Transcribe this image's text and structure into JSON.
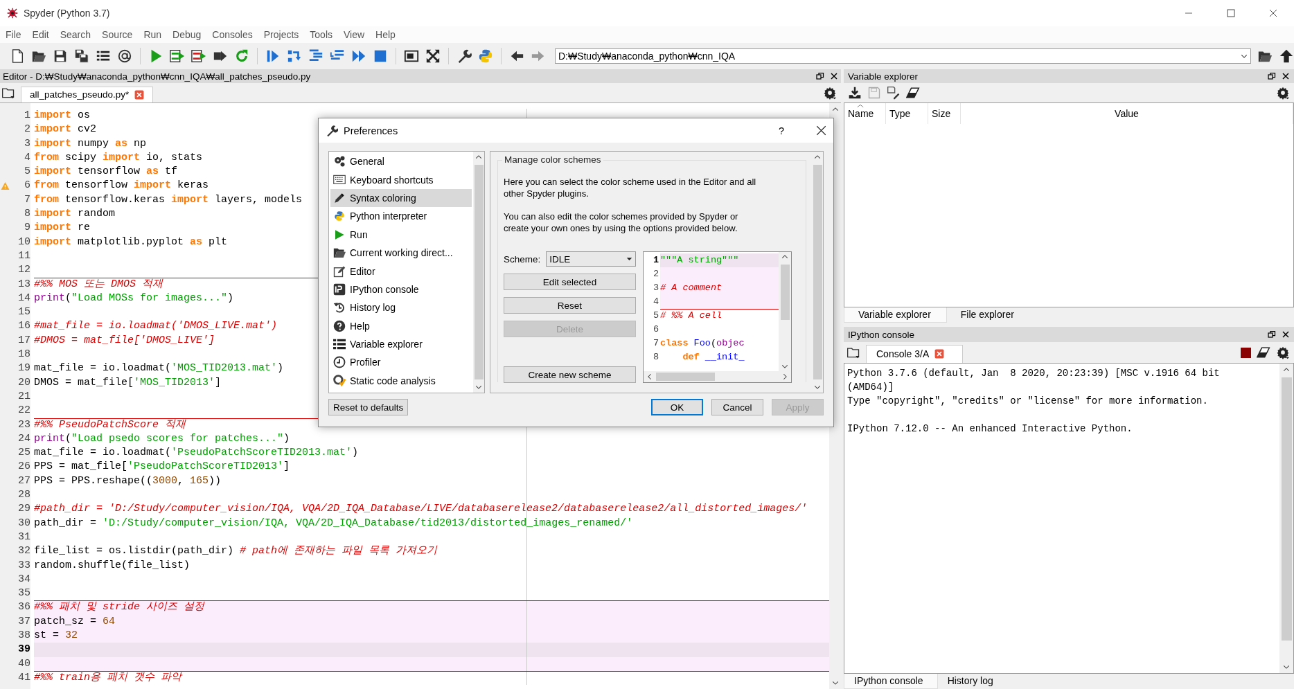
{
  "window": {
    "title": "Spyder (Python 3.7)"
  },
  "menu": [
    "File",
    "Edit",
    "Search",
    "Source",
    "Run",
    "Debug",
    "Consoles",
    "Projects",
    "Tools",
    "View",
    "Help"
  ],
  "toolbar": {
    "working_directory": "D:₩Study₩anaconda_python₩cnn_IQA"
  },
  "editor": {
    "title": "Editor - D:₩Study₩anaconda_python₩cnn_IQA₩all_patches_pseudo.py",
    "tabs": [
      {
        "label": "all_patches_pseudo.py*",
        "selected": true
      }
    ],
    "lines": [
      {
        "number": "1",
        "kind": "code",
        "warning": false,
        "tokens": [
          {
            "kind": "keyword",
            "text": "import"
          },
          {
            "kind": "plain",
            "text": " os"
          }
        ]
      },
      {
        "number": "2",
        "kind": "code",
        "warning": false,
        "tokens": [
          {
            "kind": "keyword",
            "text": "import"
          },
          {
            "kind": "plain",
            "text": " cv2"
          }
        ]
      },
      {
        "number": "3",
        "kind": "code",
        "warning": false,
        "tokens": [
          {
            "kind": "keyword",
            "text": "import"
          },
          {
            "kind": "plain",
            "text": " numpy "
          },
          {
            "kind": "keyword",
            "text": "as"
          },
          {
            "kind": "plain",
            "text": " np"
          }
        ]
      },
      {
        "number": "4",
        "kind": "code",
        "warning": false,
        "tokens": [
          {
            "kind": "keyword",
            "text": "from"
          },
          {
            "kind": "plain",
            "text": " scipy "
          },
          {
            "kind": "keyword",
            "text": "import"
          },
          {
            "kind": "plain",
            "text": " io, stats"
          }
        ]
      },
      {
        "number": "5",
        "kind": "code",
        "warning": false,
        "tokens": [
          {
            "kind": "keyword",
            "text": "import"
          },
          {
            "kind": "plain",
            "text": " tensorflow "
          },
          {
            "kind": "keyword",
            "text": "as"
          },
          {
            "kind": "plain",
            "text": " tf"
          }
        ]
      },
      {
        "number": "6",
        "kind": "code",
        "warning": true,
        "tokens": [
          {
            "kind": "keyword",
            "text": "from"
          },
          {
            "kind": "plain",
            "text": " tensorflow "
          },
          {
            "kind": "keyword",
            "text": "import"
          },
          {
            "kind": "plain",
            "text": " keras"
          }
        ]
      },
      {
        "number": "7",
        "kind": "code",
        "warning": false,
        "tokens": [
          {
            "kind": "keyword",
            "text": "from"
          },
          {
            "kind": "plain",
            "text": " tensorflow.keras "
          },
          {
            "kind": "keyword",
            "text": "import"
          },
          {
            "kind": "plain",
            "text": " layers, models"
          }
        ]
      },
      {
        "number": "8",
        "kind": "code",
        "warning": false,
        "tokens": [
          {
            "kind": "keyword",
            "text": "import"
          },
          {
            "kind": "plain",
            "text": " random"
          }
        ]
      },
      {
        "number": "9",
        "kind": "code",
        "warning": false,
        "tokens": [
          {
            "kind": "keyword",
            "text": "import"
          },
          {
            "kind": "plain",
            "text": " re"
          }
        ]
      },
      {
        "number": "10",
        "kind": "code",
        "warning": false,
        "tokens": [
          {
            "kind": "keyword",
            "text": "import"
          },
          {
            "kind": "plain",
            "text": " matplotlib.pyplot "
          },
          {
            "kind": "keyword",
            "text": "as"
          },
          {
            "kind": "plain",
            "text": " plt"
          }
        ]
      },
      {
        "number": "11",
        "kind": "code",
        "warning": false
      },
      {
        "number": "12",
        "kind": "code",
        "warning": false
      },
      {
        "number": "13",
        "kind": "cell_header",
        "warning": false,
        "tokens": [
          {
            "kind": "comment",
            "text": "#%% MOS 또는 DMOS 적재"
          }
        ]
      },
      {
        "number": "14",
        "kind": "code",
        "warning": false,
        "tokens": [
          {
            "kind": "builtin",
            "text": "print"
          },
          {
            "kind": "plain",
            "text": "("
          },
          {
            "kind": "string",
            "text": "\"Load MOSs for images...\""
          },
          {
            "kind": "plain",
            "text": ")"
          }
        ]
      },
      {
        "number": "15",
        "kind": "code",
        "warning": false
      },
      {
        "number": "16",
        "kind": "code",
        "warning": false,
        "tokens": [
          {
            "kind": "comment",
            "text": "#mat_file = io.loadmat('DMOS_LIVE.mat')"
          }
        ]
      },
      {
        "number": "17",
        "kind": "code",
        "warning": false,
        "tokens": [
          {
            "kind": "comment",
            "text": "#DMOS = mat_file['DMOS_LIVE']"
          }
        ]
      },
      {
        "number": "18",
        "kind": "code",
        "warning": false
      },
      {
        "number": "19",
        "kind": "code",
        "warning": false,
        "tokens": [
          {
            "kind": "plain",
            "text": "mat_file = io.loadmat("
          },
          {
            "kind": "string",
            "text": "'MOS_TID2013.mat'"
          },
          {
            "kind": "plain",
            "text": ")"
          }
        ]
      },
      {
        "number": "20",
        "kind": "code",
        "warning": false,
        "tokens": [
          {
            "kind": "plain",
            "text": "DMOS = mat_file["
          },
          {
            "kind": "string",
            "text": "'MOS_TID2013'"
          },
          {
            "kind": "plain",
            "text": "]"
          }
        ]
      },
      {
        "number": "21",
        "kind": "code",
        "warning": false
      },
      {
        "number": "22",
        "kind": "code",
        "warning": false
      },
      {
        "number": "23",
        "kind": "cell_header",
        "warning": false,
        "tokens": [
          {
            "kind": "comment",
            "text": "#%% PseudoPatchScore 적재"
          }
        ]
      },
      {
        "number": "24",
        "kind": "code",
        "warning": false,
        "tokens": [
          {
            "kind": "builtin",
            "text": "print"
          },
          {
            "kind": "plain",
            "text": "("
          },
          {
            "kind": "string",
            "text": "\"Load psedo scores for patches...\""
          },
          {
            "kind": "plain",
            "text": ")"
          }
        ]
      },
      {
        "number": "25",
        "kind": "code",
        "warning": false,
        "tokens": [
          {
            "kind": "plain",
            "text": "mat_file = io.loadmat("
          },
          {
            "kind": "string",
            "text": "'PseudoPatchScoreTID2013.mat'"
          },
          {
            "kind": "plain",
            "text": ")"
          }
        ]
      },
      {
        "number": "26",
        "kind": "code",
        "warning": false,
        "tokens": [
          {
            "kind": "plain",
            "text": "PPS = mat_file["
          },
          {
            "kind": "string",
            "text": "'PseudoPatchScoreTID2013'"
          },
          {
            "kind": "plain",
            "text": "]"
          }
        ]
      },
      {
        "number": "27",
        "kind": "code",
        "warning": false,
        "tokens": [
          {
            "kind": "plain",
            "text": "PPS = PPS.reshape(("
          },
          {
            "kind": "number",
            "text": "3000"
          },
          {
            "kind": "plain",
            "text": ", "
          },
          {
            "kind": "number",
            "text": "165"
          },
          {
            "kind": "plain",
            "text": "))"
          }
        ]
      },
      {
        "number": "28",
        "kind": "code",
        "warning": false
      },
      {
        "number": "29",
        "kind": "code",
        "warning": false,
        "tokens": [
          {
            "kind": "comment",
            "text": "#path_dir = 'D:/Study/computer_vision/IQA, VQA/2D_IQA_Database/LIVE/databaserelease2/databaserelease2/all_distorted_images/'"
          }
        ]
      },
      {
        "number": "30",
        "kind": "code",
        "warning": false,
        "tokens": [
          {
            "kind": "plain",
            "text": "path_dir = "
          },
          {
            "kind": "string",
            "text": "'D:/Study/computer_vision/IQA, VQA/2D_IQA_Database/tid2013/distorted_images_renamed/'"
          }
        ]
      },
      {
        "number": "31",
        "kind": "code",
        "warning": false
      },
      {
        "number": "32",
        "kind": "code",
        "warning": false,
        "tokens": [
          {
            "kind": "plain",
            "text": "file_list = os.listdir(path_dir) "
          },
          {
            "kind": "comment",
            "text": "# path에 존재하는 파일 목록 가져오기"
          }
        ]
      },
      {
        "number": "33",
        "kind": "code",
        "warning": false,
        "tokens": [
          {
            "kind": "plain",
            "text": "random.shuffle(file_list)"
          }
        ]
      },
      {
        "number": "34",
        "kind": "code",
        "warning": false
      },
      {
        "number": "35",
        "kind": "code",
        "warning": false
      },
      {
        "number": "36",
        "kind": "current_cell_header",
        "warning": false,
        "tokens": [
          {
            "kind": "comment",
            "text": "#%% 패치 및 stride 사이즈 설정"
          }
        ]
      },
      {
        "number": "37",
        "kind": "current_cell",
        "warning": false,
        "tokens": [
          {
            "kind": "plain",
            "text": "patch_sz = "
          },
          {
            "kind": "number",
            "text": "64"
          }
        ]
      },
      {
        "number": "38",
        "kind": "current_cell",
        "warning": false,
        "tokens": [
          {
            "kind": "plain",
            "text": "st = "
          },
          {
            "kind": "number",
            "text": "32"
          }
        ]
      },
      {
        "number": "39",
        "kind": "current_line",
        "warning": false
      },
      {
        "number": "40",
        "kind": "current_cell",
        "warning": false
      },
      {
        "number": "41",
        "kind": "cell_header",
        "warning": false,
        "tokens": [
          {
            "kind": "comment",
            "text": "#%% train용 패치 갯수 파악"
          }
        ]
      }
    ]
  },
  "variable_explorer": {
    "title": "Variable explorer",
    "columns": [
      "Name",
      "Type",
      "Size",
      "Value"
    ],
    "tabs": [
      {
        "label": "Variable explorer",
        "selected": true
      },
      {
        "label": "File explorer",
        "selected": false
      }
    ]
  },
  "ipython_console": {
    "title": "IPython console",
    "tabs": [
      {
        "label": "Console 3/A",
        "selected": true
      }
    ],
    "output": "Python 3.7.6 (default, Jan  8 2020, 20:23:39) [MSC v.1916 64 bit (AMD64)]\nType \"copyright\", \"credits\" or \"license\" for more information.\n\nIPython 7.12.0 -- An enhanced Interactive Python.",
    "bottom_tabs": [
      {
        "label": "IPython console",
        "selected": true
      },
      {
        "label": "History log",
        "selected": false
      }
    ]
  },
  "preferences": {
    "title": "Preferences",
    "help": "?",
    "sections": [
      {
        "label": "General",
        "selected": false
      },
      {
        "label": "Keyboard shortcuts",
        "selected": false
      },
      {
        "label": "Syntax coloring",
        "selected": true
      },
      {
        "label": "Python interpreter",
        "selected": false
      },
      {
        "label": "Run",
        "selected": false
      },
      {
        "label": "Current working direct...",
        "selected": false
      },
      {
        "label": "Editor",
        "selected": false
      },
      {
        "label": "IPython console",
        "selected": false
      },
      {
        "label": "History log",
        "selected": false
      },
      {
        "label": "Help",
        "selected": false
      },
      {
        "label": "Variable explorer",
        "selected": false
      },
      {
        "label": "Profiler",
        "selected": false
      },
      {
        "label": "Static code analysis",
        "selected": false
      }
    ],
    "group_title": "Manage color schemes",
    "paragraphs": [
      "Here you can select the color scheme used in the Editor and all other Spyder plugins.",
      "You can also edit the color schemes provided by Spyder or create your own ones by using the options provided below."
    ],
    "scheme_label": "Scheme:",
    "scheme": "IDLE",
    "buttons": [
      {
        "label": "Edit selected",
        "disabled": false
      },
      {
        "label": "Reset",
        "disabled": false
      },
      {
        "label": "Delete",
        "disabled": true
      },
      {
        "label": "Create new scheme",
        "disabled": false
      }
    ],
    "preview_lines": [
      {
        "number": "1",
        "kind": "current_line",
        "tokens": [
          {
            "kind": "string",
            "text": "\"\"\"A string\"\"\""
          }
        ]
      },
      {
        "number": "2",
        "kind": "current_cell"
      },
      {
        "number": "3",
        "kind": "current_cell",
        "tokens": [
          {
            "kind": "comment",
            "text": "# A comment"
          }
        ]
      },
      {
        "number": "4",
        "kind": "current_cell"
      },
      {
        "number": "5",
        "kind": "cell_header",
        "tokens": [
          {
            "kind": "comment",
            "text": "# %% A cell"
          }
        ]
      },
      {
        "number": "6",
        "kind": "code"
      },
      {
        "number": "7",
        "kind": "code",
        "tokens": [
          {
            "kind": "keyword",
            "text": "class"
          },
          {
            "kind": "definition",
            "text": " Foo"
          },
          {
            "kind": "plain",
            "text": "("
          },
          {
            "kind": "builtin",
            "text": "objec"
          }
        ]
      },
      {
        "number": "8",
        "kind": "code",
        "tokens": [
          {
            "kind": "keyword",
            "text": "    def"
          },
          {
            "kind": "definition",
            "text": " __init_"
          }
        ]
      }
    ],
    "reset_button": "Reset to defaults",
    "actions": [
      {
        "label": "OK",
        "default": true,
        "disabled": false
      },
      {
        "label": "Cancel",
        "default": false,
        "disabled": false
      },
      {
        "label": "Apply",
        "default": false,
        "disabled": true
      }
    ]
  }
}
